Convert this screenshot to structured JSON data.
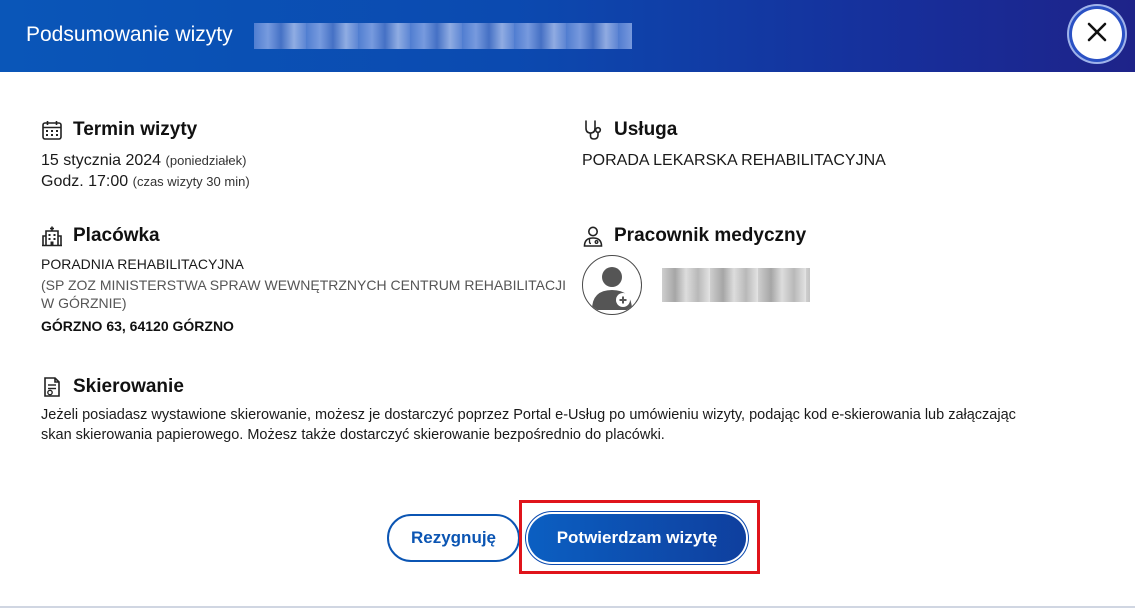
{
  "header": {
    "title": "Podsumowanie wizyty"
  },
  "icons": {
    "close": "close-icon",
    "calendar": "calendar-icon",
    "stethoscope": "stethoscope-icon",
    "hospital": "hospital-icon",
    "doctor": "doctor-icon",
    "document": "document-icon",
    "avatar": "doctor-avatar-icon"
  },
  "termin": {
    "heading": "Termin wizyty",
    "date": "15 stycznia 2024",
    "weekday": "(poniedziałek)",
    "time": "Godz. 17:00",
    "duration": "(czas wizyty 30 min)"
  },
  "usluga": {
    "heading": "Usługa",
    "name": "PORADA LEKARSKA REHABILITACYJNA"
  },
  "placowka": {
    "heading": "Placówka",
    "name": "PORADNIA REHABILITACYJNA",
    "parent_line1": "(SP ZOZ MINISTERSTWA SPRAW WEWNĘTRZNYCH CENTRUM REHABILITACJI",
    "parent_line2": "W GÓRZNIE)",
    "address": "GÓRZNO 63, 64120 GÓRZNO"
  },
  "pracownik": {
    "heading": "Pracownik medyczny"
  },
  "skierowanie": {
    "heading": "Skierowanie",
    "line1": "Jeżeli posiadasz wystawione skierowanie, możesz je dostarczyć poprzez Portal e-Usług po umówieniu wizyty, podając kod e-skierowania lub załączając",
    "line2": "skan skierowania papierowego. Możesz także dostarczyć skierowanie bezpośrednio do placówki."
  },
  "buttons": {
    "cancel": "Rezygnuję",
    "confirm": "Potwierdzam wizytę"
  },
  "colors": {
    "header_start": "#0a56b8",
    "header_end": "#1e2389",
    "primary": "#0b55b3",
    "highlight": "#e0141b"
  }
}
